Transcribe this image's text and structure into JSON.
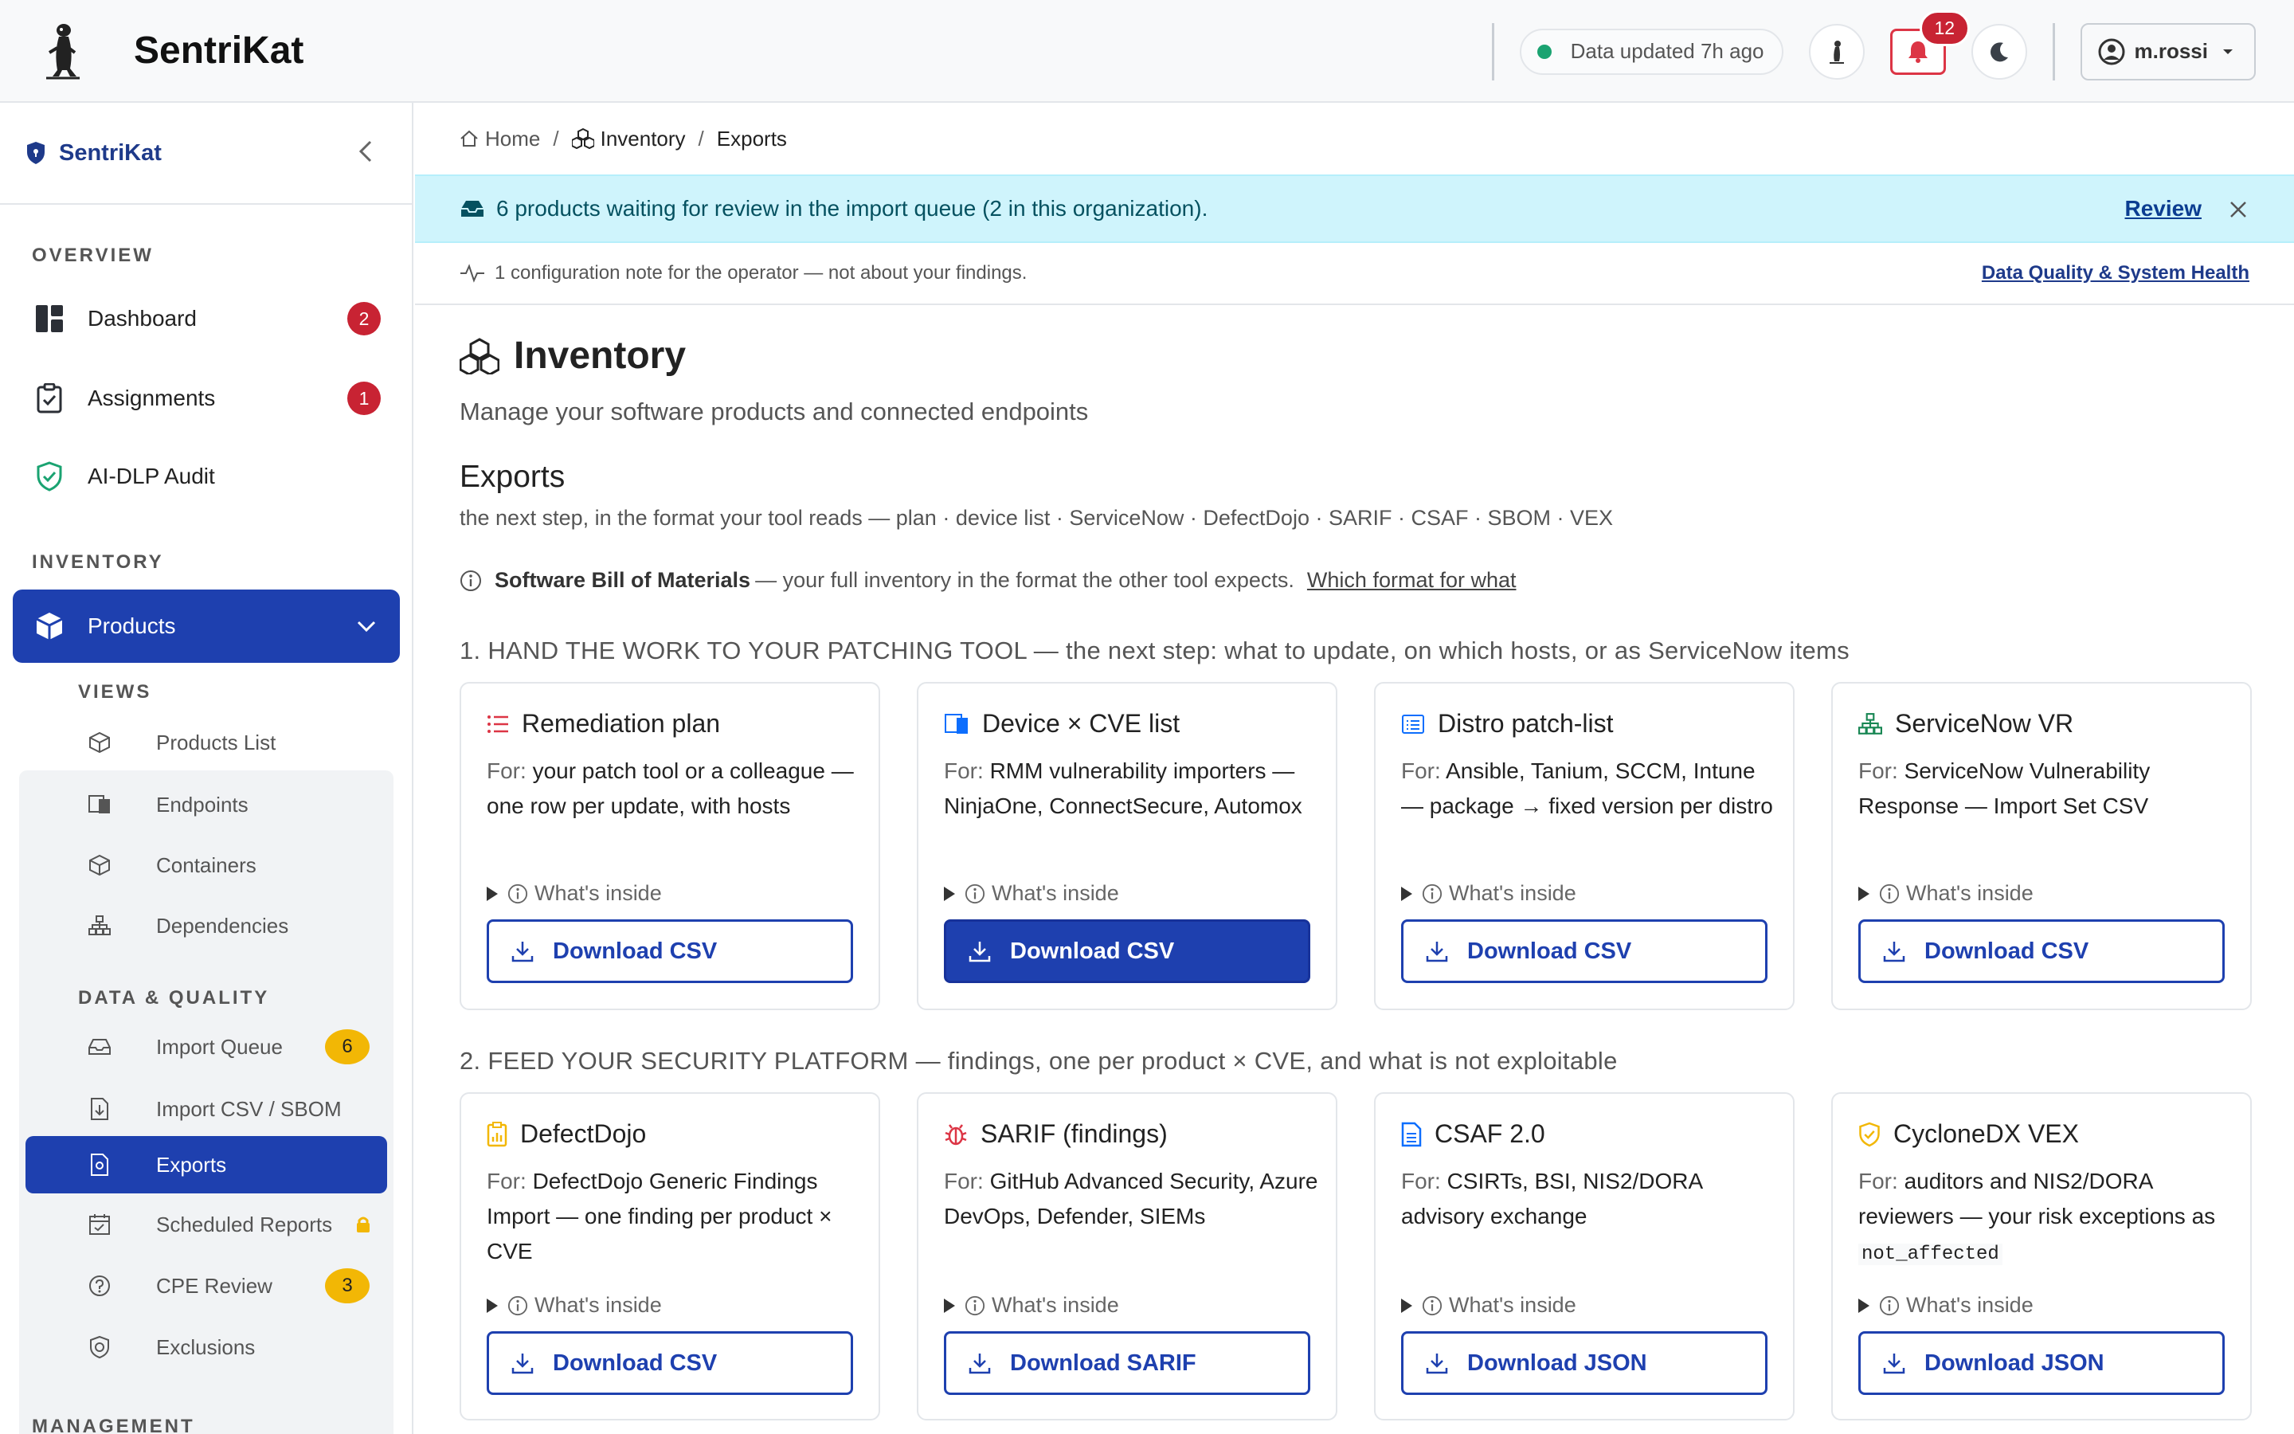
{
  "app": {
    "name": "SentriKat"
  },
  "topbar": {
    "status_text": "Data updated 7h ago",
    "notifications_count": "12",
    "user_name": "m.rossi"
  },
  "sidebar": {
    "title": "SentriKat",
    "sections": {
      "overview": "OVERVIEW",
      "inventory": "INVENTORY",
      "management": "MANAGEMENT"
    },
    "overview_items": [
      {
        "label": "Dashboard",
        "badge": "2",
        "icon": "dashboard-icon"
      },
      {
        "label": "Assignments",
        "badge": "1",
        "icon": "clipboard-check-icon"
      },
      {
        "label": "AI-DLP Audit",
        "icon": "shield-check-icon"
      }
    ],
    "products": {
      "label": "Products",
      "icon": "box-icon"
    },
    "views_label": "VIEWS",
    "views": [
      {
        "label": "Products List",
        "icon": "box-icon"
      },
      {
        "label": "Endpoints",
        "icon": "devices-icon"
      },
      {
        "label": "Containers",
        "icon": "box-icon"
      },
      {
        "label": "Dependencies",
        "icon": "diagram-icon"
      }
    ],
    "quality_label": "DATA & QUALITY",
    "quality": [
      {
        "label": "Import Queue",
        "badge": "6",
        "icon": "inbox-icon"
      },
      {
        "label": "Import CSV / SBOM",
        "icon": "file-import-icon"
      },
      {
        "label": "Exports",
        "icon": "file-export-icon",
        "active": true
      },
      {
        "label": "Scheduled Reports",
        "icon": "calendar-icon",
        "locked": true
      },
      {
        "label": "CPE Review",
        "badge": "3",
        "icon": "question-icon"
      },
      {
        "label": "Exclusions",
        "icon": "shield-slash-icon"
      }
    ]
  },
  "breadcrumb": {
    "home": "Home",
    "inventory": "Inventory",
    "current": "Exports"
  },
  "alert": {
    "text": "6 products waiting for review in the import queue (2 in this organization).",
    "link": "Review"
  },
  "note": {
    "text": "1 configuration note for the operator — not about your findings.",
    "link": "Data Quality & System Health"
  },
  "page": {
    "title": "Inventory",
    "subtitle": "Manage your software products and connected endpoints",
    "heading": "Exports",
    "formats": "the next step, in the format your tool reads — plan · device list · ServiceNow · DefectDojo · SARIF · CSAF · SBOM · VEX",
    "sbom_bold": "Software Bill of Materials",
    "sbom_text": "— your full inventory in the format the other tool expects.",
    "sbom_link": "Which format for what"
  },
  "sections": [
    {
      "title": "1. HAND THE WORK TO YOUR PATCHING TOOL — the next step: what to update, on which hosts, or as ServiceNow items",
      "cards": [
        {
          "title": "Remediation plan",
          "for": "For:",
          "desc": "your patch tool or a colleague — one row per update, with hosts",
          "inside": "What's inside",
          "button": "Download CSV",
          "icon": "list-icon",
          "color": "#dc3545"
        },
        {
          "title": "Device × CVE list",
          "for": "For:",
          "desc": "RMM vulnerability importers — NinjaOne, ConnectSecure, Automox",
          "inside": "What's inside",
          "button": "Download CSV",
          "icon": "devices-icon",
          "color": "#0d6efd",
          "primary": true
        },
        {
          "title": "Distro patch-list",
          "for": "For:",
          "desc": "Ansible, Tanium, SCCM, Intune — package → fixed version per distro",
          "inside": "What's inside",
          "button": "Download CSV",
          "icon": "card-list-icon",
          "color": "#0d6efd"
        },
        {
          "title": "ServiceNow VR",
          "for": "For:",
          "desc": "ServiceNow Vulnerability Response — Import Set CSV",
          "inside": "What's inside",
          "button": "Download CSV",
          "icon": "diagram-icon",
          "color": "#198754"
        }
      ]
    },
    {
      "title": "2. FEED YOUR SECURITY PLATFORM — findings, one per product × CVE, and what is not exploitable",
      "cards": [
        {
          "title": "DefectDojo",
          "for": "For:",
          "desc": "DefectDojo Generic Findings Import — one finding per product × CVE",
          "inside": "What's inside",
          "button": "Download CSV",
          "icon": "clipboard-data-icon",
          "color": "#f2b705"
        },
        {
          "title": "SARIF (findings)",
          "for": "For:",
          "desc": "GitHub Advanced Security, Azure DevOps, Defender, SIEMs",
          "inside": "What's inside",
          "button": "Download SARIF",
          "icon": "bug-icon",
          "color": "#dc3545"
        },
        {
          "title": "CSAF 2.0",
          "for": "For:",
          "desc": "CSIRTs, BSI, NIS2/DORA advisory exchange",
          "inside": "What's inside",
          "button": "Download JSON",
          "icon": "file-text-icon",
          "color": "#0d6efd"
        },
        {
          "title": "CycloneDX VEX",
          "for": "For:",
          "desc": "auditors and NIS2/DORA reviewers — your risk exceptions as",
          "code": "not_affected",
          "inside": "What's inside",
          "button": "Download JSON",
          "icon": "shield-check-icon",
          "color": "#f2b705"
        }
      ]
    }
  ]
}
